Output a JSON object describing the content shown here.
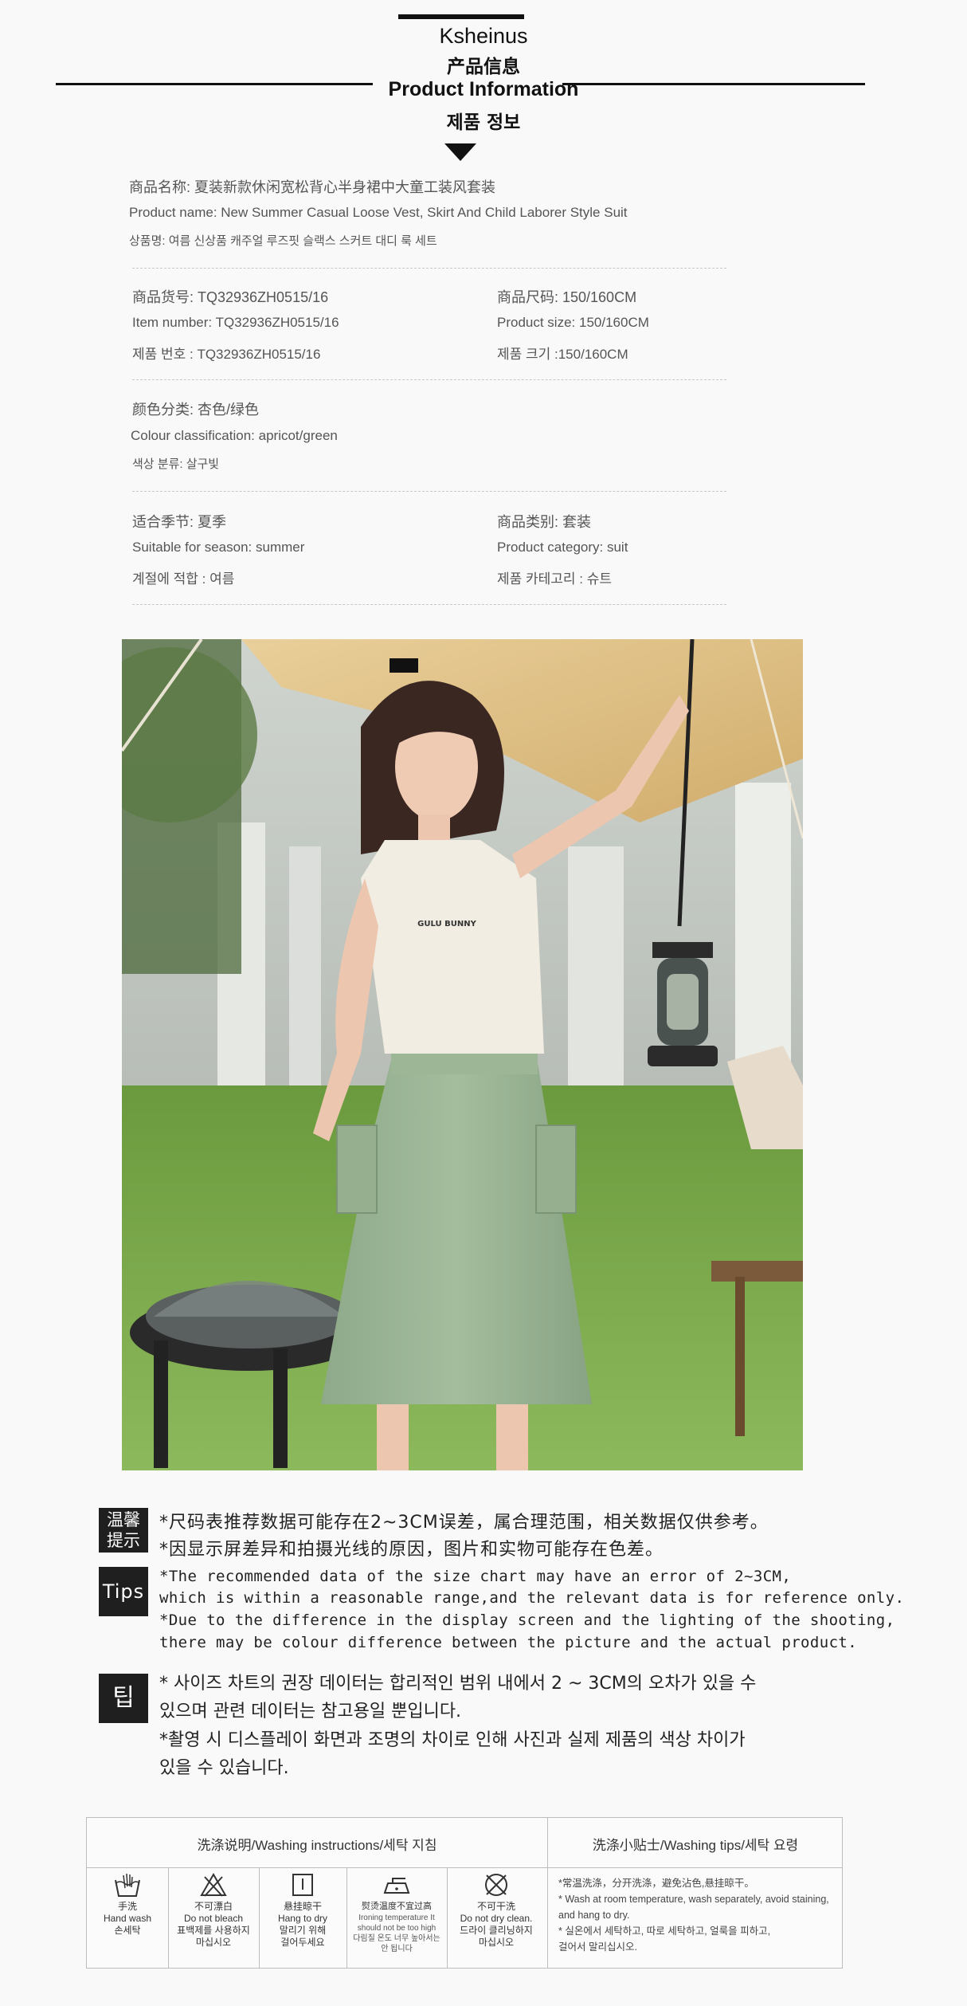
{
  "header": {
    "brand": "Ksheinus",
    "title_cn": "产品信息",
    "title_en": "Product Information",
    "title_ko": "제품 정보"
  },
  "product": {
    "name_cn": "商品名称:  夏装新款休闲宽松背心半身裙中大童工装风套装",
    "name_en": "Product name:  New Summer Casual Loose Vest, Skirt And Child Laborer Style Suit",
    "name_ko": "상품명:  여름 신상품 캐주얼 루즈핏 슬랙스 스커트 대디 룩 세트",
    "item_cn": "商品货号:  TQ32936ZH0515/16",
    "item_en": "Item number:  TQ32936ZH0515/16",
    "item_ko": "제품 번호 : TQ32936ZH0515/16",
    "size_cn": "商品尺码:  150/160CM",
    "size_en": "Product size:  150/160CM",
    "size_ko": "제품 크기 :150/160CM",
    "color_cn": "颜色分类:  杏色/绿色",
    "color_en": "Colour classification:  apricot/green",
    "color_ko": "색상 분류:  살구빛",
    "season_cn": "适合季节:  夏季",
    "season_en": "Suitable for season:  summer",
    "season_ko": "계절에 적합 : 여름",
    "category_cn": "商品类别:  套装",
    "category_en": "Product category:  suit",
    "category_ko": "제품 카테고리 : 슈트"
  },
  "photo": {
    "shirt_print": "GULU BUNNY"
  },
  "tips": {
    "badge_cn_1": "温馨",
    "badge_cn_2": "提示",
    "badge_en": "Tips",
    "badge_ko": "팁",
    "cn_1": "*尺码表推荐数据可能存在2~3CM误差，属合理范围，相关数据仅供参考。",
    "cn_2": "*因显示屏差异和拍摄光线的原因，图片和实物可能存在色差。",
    "en_1": "*The recommended data of the size chart may have an error of 2~3CM,",
    "en_2": " which is within a reasonable range,and the relevant data is for reference only.",
    "en_3": "*Due to the difference in the display screen and the lighting of the shooting,",
    "en_4": " there may be colour difference between the picture and the actual product.",
    "ko_1": "* 사이즈 차트의 권장 데이터는 합리적인 범위 내에서 2 ~ 3CM의 오차가 있을 수",
    "ko_2": "  있으며 관련 데이터는 참고용일 뿐입니다.",
    "ko_3": "*촬영 시 디스플레이 화면과 조명의 차이로 인해 사진과 실제 제품의 색상 차이가",
    "ko_4": "  있을 수 있습니다."
  },
  "washing": {
    "instructions_header": "洗涤说明/Washing instructions/세탁 지침",
    "tips_header": "洗涤小贴士/Washing tips/세탁 요령",
    "items": [
      {
        "icon": "hand-wash-icon",
        "l1": "手洗",
        "l2": "Hand wash",
        "l3": "손세탁",
        "l4": ""
      },
      {
        "icon": "no-bleach-icon",
        "l1": "不可漂白",
        "l2": "Do not bleach",
        "l3": "표백제를 사용하지",
        "l4": "마십시오"
      },
      {
        "icon": "hang-dry-icon",
        "l1": "悬挂晾干",
        "l2": "Hang to dry",
        "l3": "말리기 위해",
        "l4": "걸어두세요"
      },
      {
        "icon": "iron-low-icon",
        "l1": "熨烫温度不宜过高",
        "l2": "Ironing temperature It",
        "l3": "should not be too high",
        "l4": "다림질 온도 너무 높아서는 안 됩니다"
      },
      {
        "icon": "no-dry-clean-icon",
        "l1": "不可干洗",
        "l2": "Do not dry clean.",
        "l3": "드라이 클리닝하지",
        "l4": "마십시오"
      }
    ],
    "tips_lines": [
      "*常温洗涤，分开洗涤，避免沾色,悬挂晾干。",
      "* Wash at room temperature, wash separately, avoid staining,",
      "and hang to dry.",
      "* 실온에서 세탁하고, 따로 세탁하고, 얼룩을 피하고,",
      "걸어서 말리십시오."
    ]
  }
}
